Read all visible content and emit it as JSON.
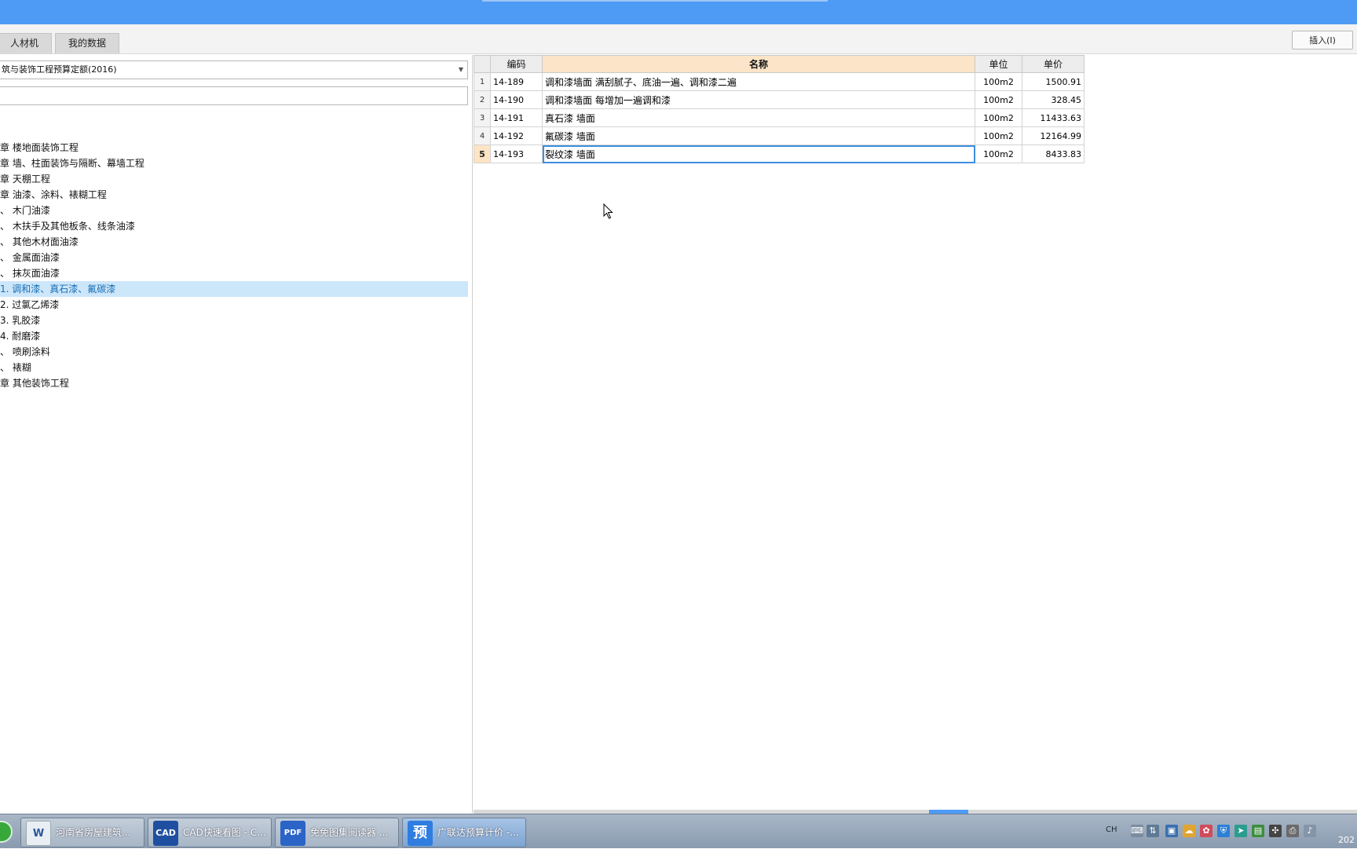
{
  "tabs": [
    {
      "label": "人材机"
    },
    {
      "label": "我的数据"
    }
  ],
  "toolbar": {
    "insert_label": "插入(I)"
  },
  "library_select": {
    "value": "筑与装饰工程预算定额(2016)"
  },
  "search": {
    "value": "",
    "placeholder": ""
  },
  "tree": {
    "items": [
      {
        "label": "章 楼地面装饰工程"
      },
      {
        "label": "章 墙、柱面装饰与隔断、幕墙工程"
      },
      {
        "label": "章 天棚工程"
      },
      {
        "label": "章 油漆、涂料、裱糊工程"
      },
      {
        "label": "、 木门油漆"
      },
      {
        "label": "、 木扶手及其他板条、线条油漆"
      },
      {
        "label": "、 其他木材面油漆"
      },
      {
        "label": "、 金属面油漆"
      },
      {
        "label": "、 抹灰面油漆"
      },
      {
        "label": " 1. 调和漆、真石漆、氟碳漆"
      },
      {
        "label": " 2. 过氯乙烯漆"
      },
      {
        "label": " 3. 乳胶漆"
      },
      {
        "label": " 4. 耐磨漆"
      },
      {
        "label": "、 喷刷涂料"
      },
      {
        "label": "、 裱糊"
      },
      {
        "label": "章 其他装饰工程"
      }
    ],
    "selected_index": 9
  },
  "table": {
    "headers": {
      "rownum": "",
      "code": "编码",
      "name": "名称",
      "unit": "单位",
      "price": "单价"
    },
    "rows": [
      {
        "num": "1",
        "code": "14-189",
        "name": "调和漆墙面 满刮腻子、底油一遍、调和漆二遍",
        "unit": "100m2",
        "price": "1500.91"
      },
      {
        "num": "2",
        "code": "14-190",
        "name": "调和漆墙面 每增加一遍调和漆",
        "unit": "100m2",
        "price": "328.45"
      },
      {
        "num": "3",
        "code": "14-191",
        "name": "真石漆 墙面",
        "unit": "100m2",
        "price": "11433.63"
      },
      {
        "num": "4",
        "code": "14-192",
        "name": "氟碳漆 墙面",
        "unit": "100m2",
        "price": "12164.99"
      },
      {
        "num": "5",
        "code": "14-193",
        "name": "裂纹漆 墙面",
        "unit": "100m2",
        "price": "8433.83"
      }
    ],
    "current_row": 5
  },
  "taskbar": {
    "items": [
      {
        "label": "河南省房屋建筑...",
        "icon": "word-doc-icon"
      },
      {
        "label": "CAD快速看图 - C...",
        "icon": "cad-icon"
      },
      {
        "label": "免免图集阅读器 ...",
        "icon": "pdf-reader-icon"
      },
      {
        "label": "广联达预算计价 -...",
        "icon": "yu-app-icon"
      }
    ],
    "tray_lang": "CH",
    "clock": "202"
  },
  "colors": {
    "titlebar": "#4d9bf5",
    "selection": "#cce6fa",
    "header_active": "#fce4c8",
    "focus": "#3d8fe0"
  }
}
